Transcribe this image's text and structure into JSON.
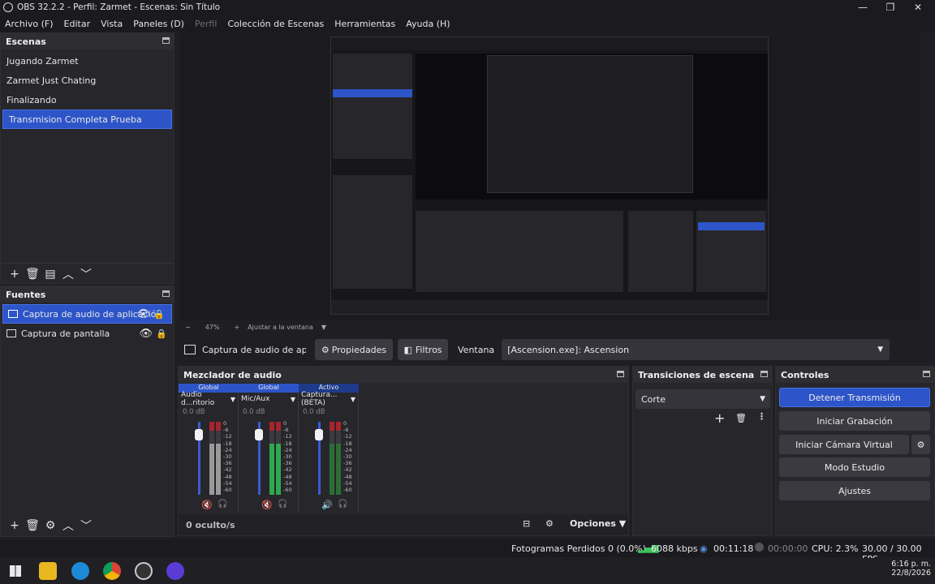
{
  "window": {
    "title": "OBS 32.2.2 - Perfil: Zarmet - Escenas: Sin Título"
  },
  "menu": [
    "Archivo (F)",
    "Editar",
    "Vista",
    "Paneles (D)",
    "Perfil",
    "Colección de Escenas",
    "Herramientas",
    "Ayuda (H)"
  ],
  "scenes": {
    "title": "Escenas",
    "items": [
      "Jugando Zarmet",
      "Zarmet Just Chating",
      "Finalizando",
      "Transmision Completa Prueba"
    ],
    "selected": 3
  },
  "sources": {
    "title": "Fuentes",
    "items": [
      "Captura de audio de aplicació",
      "Captura de pantalla"
    ]
  },
  "preview": {
    "zoom": "47%",
    "fit_label": "Ajustar a la ventana"
  },
  "source_toolbar": {
    "source_name": "Captura de audio de aplicac",
    "properties": "Propiedades",
    "filters": "Filtros",
    "window_label": "Ventana",
    "window_value": "[Ascension.exe]: Ascension"
  },
  "mixer": {
    "title": "Mezclador de audio",
    "channels": [
      {
        "tag": "Global",
        "name": "Audio d...ritorio",
        "db": "0.0 dB",
        "level": 0.9,
        "muted": true
      },
      {
        "tag": "Global",
        "name": "Mic/Aux",
        "db": "0.0 dB",
        "level": 0.9,
        "muted": true
      },
      {
        "tag": "Activo",
        "name": "Captura... (BETA)",
        "db": "0.0 dB",
        "level": 0.9,
        "muted": false
      }
    ],
    "scale": [
      "0",
      "-6",
      "-12",
      "-18",
      "-24",
      "-30",
      "-36",
      "-42",
      "-48",
      "-54",
      "-60"
    ],
    "hidden_count": "0 oculto/s",
    "options": "Opciones"
  },
  "transitions": {
    "title": "Transiciones de escena",
    "selected": "Corte"
  },
  "controls": {
    "title": "Controles",
    "buttons": [
      "Detener Transmisión",
      "Iniciar Grabación",
      "Iniciar Cámara Virtual",
      "Modo Estudio",
      "Ajustes"
    ]
  },
  "status": {
    "dropped": "Fotogramas Perdidos 0 (0.0%)",
    "bitrate": "6088 kbps",
    "stream_time": "00:11:18",
    "rec_time": "00:00:00",
    "cpu": "CPU: 2.3%",
    "fps": "30.00 / 30.00 FPS"
  },
  "taskbar": {
    "time": "6:16 p. m.",
    "date": "22/8/2026"
  },
  "colors": {
    "accent": "#2d55c9",
    "panel": "#26262b",
    "background": "#1f1f23",
    "meter_green": "#2fa84f",
    "meter_red": "#a9242c"
  }
}
